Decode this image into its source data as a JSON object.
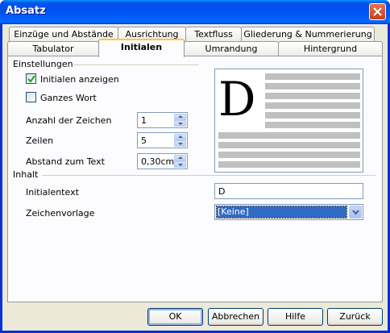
{
  "window": {
    "title": "Absatz"
  },
  "tabs_row1": [
    {
      "label": "Einzüge und Abstände"
    },
    {
      "label": "Ausrichtung"
    },
    {
      "label": "Textfluss"
    },
    {
      "label": "Gliederung & Nummerierung"
    }
  ],
  "tabs_row2": [
    {
      "label": "Tabulator"
    },
    {
      "label": "Initialen"
    },
    {
      "label": "Umrandung"
    },
    {
      "label": "Hintergrund"
    }
  ],
  "settings": {
    "group_label": "Einstellungen",
    "show_initials": {
      "label": "Initialen anzeigen",
      "checked": true
    },
    "whole_word": {
      "label": "Ganzes Wort",
      "checked": false
    },
    "num_chars": {
      "label": "Anzahl der Zeichen",
      "value": "1"
    },
    "lines": {
      "label": "Zeilen",
      "value": "5"
    },
    "spacing": {
      "label": "Abstand zum Text",
      "value": "0,30cm"
    }
  },
  "preview": {
    "drop_letter": "D"
  },
  "content": {
    "group_label": "Inhalt",
    "initial_text": {
      "label": "Initialentext",
      "value": "D"
    },
    "char_style": {
      "label": "Zeichenvorlage",
      "value": "[Keine]"
    }
  },
  "buttons": {
    "ok": "OK",
    "cancel": "Abbrechen",
    "help": "Hilfe",
    "reset": "Zurück"
  }
}
